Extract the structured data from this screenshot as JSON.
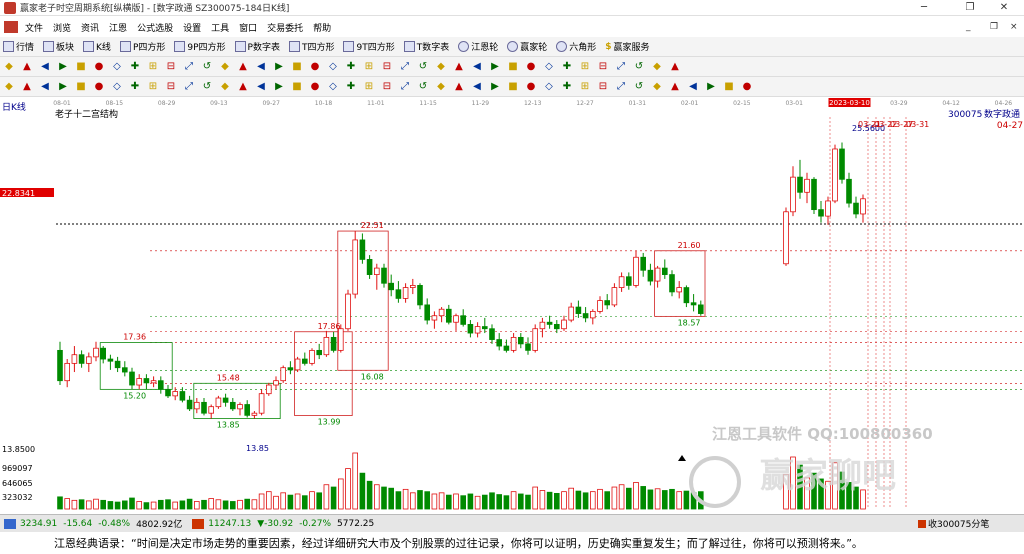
{
  "window": {
    "title": "赢家老子时空周期系统[纵横版] - [数字政通  SZ300075-184日K线]",
    "minimize": "─",
    "restore": "❐",
    "close": "✕"
  },
  "menu": [
    "文件",
    "浏览",
    "资讯",
    "江恩",
    "公式选股",
    "设置",
    "工具",
    "窗口",
    "交易委托",
    "帮助"
  ],
  "mdi_controls": [
    "_",
    "❐",
    "×"
  ],
  "toolbar1": [
    {
      "label": "行情",
      "icon": "grid-icon"
    },
    {
      "label": "板块",
      "icon": "blocks-icon"
    },
    {
      "label": "K线",
      "icon": "kline-icon"
    },
    {
      "label": "P四方形",
      "icon": "p-square-icon"
    },
    {
      "label": "9P四方形",
      "icon": "9p-square-icon"
    },
    {
      "label": "P数字表",
      "icon": "p-table-icon"
    },
    {
      "label": "T四方形",
      "icon": "t-square-icon"
    },
    {
      "label": "9T四方形",
      "icon": "9t-square-icon"
    },
    {
      "label": "T数字表",
      "icon": "t-table-icon"
    },
    {
      "label": "江恩轮",
      "icon": "gann-wheel-icon"
    },
    {
      "label": "赢家轮",
      "icon": "winner-wheel-icon"
    },
    {
      "label": "六角形",
      "icon": "hexagon-icon"
    },
    {
      "label": "赢家服务",
      "icon": "dollar-icon"
    }
  ],
  "toolbar2_count": 38,
  "toolbar3_count": 42,
  "chart_data": {
    "type": "candlestick",
    "title": "老子十二宫结构",
    "period_label": "日K线",
    "stock_code": "300075",
    "stock_name": "数字政通",
    "current_price_label": "22.8341",
    "min_price_label": "13.8500",
    "date_axis": [
      "08-01",
      "08-15",
      "08-29",
      "09-13",
      "09-27",
      "10-18",
      "11-01",
      "11-15",
      "11-29",
      "12-13",
      "12-27",
      "01-31",
      "02-01",
      "02-15",
      "03-01",
      "2023-03-10",
      "03-29",
      "04-12",
      "04-26"
    ],
    "date_axis_right": "04-27",
    "price_range": [
      13.0,
      27.5
    ],
    "volume_ticks": [
      "969097",
      "646065",
      "323032"
    ],
    "candles": [
      {
        "o": 17.0,
        "h": 17.4,
        "l": 15.4,
        "c": 15.6
      },
      {
        "o": 15.6,
        "h": 16.6,
        "l": 15.3,
        "c": 16.4
      },
      {
        "o": 16.4,
        "h": 17.2,
        "l": 16.0,
        "c": 16.8
      },
      {
        "o": 16.8,
        "h": 17.0,
        "l": 16.2,
        "c": 16.4
      },
      {
        "o": 16.4,
        "h": 16.9,
        "l": 16.0,
        "c": 16.7
      },
      {
        "o": 16.7,
        "h": 17.4,
        "l": 16.5,
        "c": 17.1
      },
      {
        "o": 17.1,
        "h": 17.2,
        "l": 16.4,
        "c": 16.6
      },
      {
        "o": 16.6,
        "h": 16.8,
        "l": 16.1,
        "c": 16.5
      },
      {
        "o": 16.5,
        "h": 16.7,
        "l": 16.0,
        "c": 16.2
      },
      {
        "o": 16.2,
        "h": 16.5,
        "l": 15.8,
        "c": 16.0
      },
      {
        "o": 16.0,
        "h": 16.2,
        "l": 15.2,
        "c": 15.4
      },
      {
        "o": 15.4,
        "h": 15.9,
        "l": 15.2,
        "c": 15.7
      },
      {
        "o": 15.7,
        "h": 15.9,
        "l": 15.2,
        "c": 15.5
      },
      {
        "o": 15.5,
        "h": 15.8,
        "l": 15.3,
        "c": 15.6
      },
      {
        "o": 15.6,
        "h": 15.8,
        "l": 15.0,
        "c": 15.2
      },
      {
        "o": 15.2,
        "h": 15.4,
        "l": 14.8,
        "c": 14.9
      },
      {
        "o": 14.9,
        "h": 15.3,
        "l": 14.7,
        "c": 15.1
      },
      {
        "o": 15.1,
        "h": 15.3,
        "l": 14.6,
        "c": 14.7
      },
      {
        "o": 14.7,
        "h": 14.9,
        "l": 14.2,
        "c": 14.3
      },
      {
        "o": 14.3,
        "h": 14.8,
        "l": 14.1,
        "c": 14.6
      },
      {
        "o": 14.6,
        "h": 14.8,
        "l": 14.0,
        "c": 14.1
      },
      {
        "o": 14.1,
        "h": 14.5,
        "l": 13.85,
        "c": 14.4
      },
      {
        "o": 14.4,
        "h": 14.9,
        "l": 14.3,
        "c": 14.8
      },
      {
        "o": 14.8,
        "h": 15.0,
        "l": 14.4,
        "c": 14.6
      },
      {
        "o": 14.6,
        "h": 14.8,
        "l": 14.2,
        "c": 14.3
      },
      {
        "o": 14.3,
        "h": 14.6,
        "l": 14.0,
        "c": 14.5
      },
      {
        "o": 14.5,
        "h": 14.7,
        "l": 13.9,
        "c": 14.0
      },
      {
        "o": 14.0,
        "h": 14.2,
        "l": 13.85,
        "c": 14.1
      },
      {
        "o": 14.1,
        "h": 15.2,
        "l": 14.0,
        "c": 15.0
      },
      {
        "o": 15.0,
        "h": 15.5,
        "l": 14.9,
        "c": 15.4
      },
      {
        "o": 15.4,
        "h": 15.8,
        "l": 15.2,
        "c": 15.6
      },
      {
        "o": 15.6,
        "h": 16.3,
        "l": 15.5,
        "c": 16.2
      },
      {
        "o": 16.2,
        "h": 16.5,
        "l": 15.9,
        "c": 16.1
      },
      {
        "o": 16.1,
        "h": 16.7,
        "l": 16.0,
        "c": 16.6
      },
      {
        "o": 16.6,
        "h": 16.9,
        "l": 16.3,
        "c": 16.4
      },
      {
        "o": 16.4,
        "h": 17.1,
        "l": 16.3,
        "c": 17.0
      },
      {
        "o": 17.0,
        "h": 17.3,
        "l": 16.6,
        "c": 16.8
      },
      {
        "o": 16.8,
        "h": 17.9,
        "l": 16.7,
        "c": 17.6
      },
      {
        "o": 17.6,
        "h": 17.86,
        "l": 16.9,
        "c": 17.0
      },
      {
        "o": 17.0,
        "h": 18.2,
        "l": 16.9,
        "c": 18.0
      },
      {
        "o": 18.0,
        "h": 19.8,
        "l": 17.9,
        "c": 19.6
      },
      {
        "o": 19.6,
        "h": 22.51,
        "l": 19.4,
        "c": 22.1
      },
      {
        "o": 22.1,
        "h": 22.4,
        "l": 21.0,
        "c": 21.2
      },
      {
        "o": 21.2,
        "h": 21.4,
        "l": 20.3,
        "c": 20.5
      },
      {
        "o": 20.5,
        "h": 21.0,
        "l": 19.8,
        "c": 20.8
      },
      {
        "o": 20.8,
        "h": 21.0,
        "l": 19.9,
        "c": 20.1
      },
      {
        "o": 20.1,
        "h": 20.5,
        "l": 19.5,
        "c": 19.8
      },
      {
        "o": 19.8,
        "h": 20.2,
        "l": 19.2,
        "c": 19.4
      },
      {
        "o": 19.4,
        "h": 20.1,
        "l": 19.2,
        "c": 19.9
      },
      {
        "o": 19.9,
        "h": 20.3,
        "l": 19.6,
        "c": 20.0
      },
      {
        "o": 20.0,
        "h": 20.1,
        "l": 18.9,
        "c": 19.1
      },
      {
        "o": 19.1,
        "h": 19.4,
        "l": 18.2,
        "c": 18.4
      },
      {
        "o": 18.4,
        "h": 18.8,
        "l": 18.0,
        "c": 18.6
      },
      {
        "o": 18.6,
        "h": 19.0,
        "l": 18.3,
        "c": 18.9
      },
      {
        "o": 18.9,
        "h": 19.1,
        "l": 18.2,
        "c": 18.3
      },
      {
        "o": 18.3,
        "h": 18.7,
        "l": 17.9,
        "c": 18.6
      },
      {
        "o": 18.6,
        "h": 18.9,
        "l": 18.1,
        "c": 18.2
      },
      {
        "o": 18.2,
        "h": 18.4,
        "l": 17.6,
        "c": 17.8
      },
      {
        "o": 17.8,
        "h": 18.3,
        "l": 17.6,
        "c": 18.1
      },
      {
        "o": 18.1,
        "h": 18.5,
        "l": 17.8,
        "c": 18.0
      },
      {
        "o": 18.0,
        "h": 18.2,
        "l": 17.3,
        "c": 17.5
      },
      {
        "o": 17.5,
        "h": 17.8,
        "l": 17.0,
        "c": 17.2
      },
      {
        "o": 17.2,
        "h": 17.5,
        "l": 16.9,
        "c": 17.0
      },
      {
        "o": 17.0,
        "h": 17.8,
        "l": 16.9,
        "c": 17.6
      },
      {
        "o": 17.6,
        "h": 17.8,
        "l": 17.1,
        "c": 17.3
      },
      {
        "o": 17.3,
        "h": 17.6,
        "l": 16.8,
        "c": 17.0
      },
      {
        "o": 17.0,
        "h": 18.2,
        "l": 16.9,
        "c": 18.0
      },
      {
        "o": 18.0,
        "h": 18.5,
        "l": 17.6,
        "c": 18.3
      },
      {
        "o": 18.3,
        "h": 18.6,
        "l": 18.0,
        "c": 18.2
      },
      {
        "o": 18.2,
        "h": 18.4,
        "l": 17.8,
        "c": 18.0
      },
      {
        "o": 18.0,
        "h": 18.6,
        "l": 17.9,
        "c": 18.4
      },
      {
        "o": 18.4,
        "h": 19.2,
        "l": 18.3,
        "c": 19.0
      },
      {
        "o": 19.0,
        "h": 19.3,
        "l": 18.5,
        "c": 18.7
      },
      {
        "o": 18.7,
        "h": 19.0,
        "l": 18.3,
        "c": 18.5
      },
      {
        "o": 18.5,
        "h": 18.9,
        "l": 18.2,
        "c": 18.8
      },
      {
        "o": 18.8,
        "h": 19.5,
        "l": 18.7,
        "c": 19.3
      },
      {
        "o": 19.3,
        "h": 19.6,
        "l": 18.9,
        "c": 19.1
      },
      {
        "o": 19.1,
        "h": 20.1,
        "l": 19.0,
        "c": 19.9
      },
      {
        "o": 19.9,
        "h": 20.6,
        "l": 19.7,
        "c": 20.4
      },
      {
        "o": 20.4,
        "h": 20.6,
        "l": 19.8,
        "c": 20.0
      },
      {
        "o": 20.0,
        "h": 21.6,
        "l": 19.9,
        "c": 21.3
      },
      {
        "o": 21.3,
        "h": 21.5,
        "l": 20.4,
        "c": 20.7
      },
      {
        "o": 20.7,
        "h": 21.0,
        "l": 20.0,
        "c": 20.2
      },
      {
        "o": 20.2,
        "h": 20.9,
        "l": 19.9,
        "c": 20.8
      },
      {
        "o": 20.8,
        "h": 21.2,
        "l": 20.3,
        "c": 20.5
      },
      {
        "o": 20.5,
        "h": 20.7,
        "l": 19.5,
        "c": 19.7
      },
      {
        "o": 19.7,
        "h": 20.2,
        "l": 19.4,
        "c": 19.9
      },
      {
        "o": 19.9,
        "h": 20.0,
        "l": 19.0,
        "c": 19.2
      },
      {
        "o": 19.2,
        "h": 19.6,
        "l": 18.8,
        "c": 19.1
      },
      {
        "o": 19.1,
        "h": 19.3,
        "l": 18.6,
        "c": 18.7
      },
      {
        "o": 21.0,
        "h": 23.6,
        "l": 20.9,
        "c": 23.4
      },
      {
        "o": 23.4,
        "h": 25.5,
        "l": 23.2,
        "c": 25.0
      },
      {
        "o": 25.0,
        "h": 25.8,
        "l": 24.0,
        "c": 24.3
      },
      {
        "o": 24.3,
        "h": 25.2,
        "l": 23.8,
        "c": 24.9
      },
      {
        "o": 24.9,
        "h": 25.0,
        "l": 23.3,
        "c": 23.5
      },
      {
        "o": 23.5,
        "h": 23.9,
        "l": 22.9,
        "c": 23.2
      },
      {
        "o": 23.2,
        "h": 24.1,
        "l": 22.8,
        "c": 23.9
      },
      {
        "o": 23.9,
        "h": 26.5,
        "l": 23.8,
        "c": 26.3
      },
      {
        "o": 26.3,
        "h": 26.6,
        "l": 24.7,
        "c": 24.9
      },
      {
        "o": 24.9,
        "h": 25.2,
        "l": 23.6,
        "c": 23.8
      },
      {
        "o": 23.8,
        "h": 24.1,
        "l": 23.1,
        "c": 23.3
      },
      {
        "o": 23.3,
        "h": 24.2,
        "l": 22.9,
        "c": 24.0
      }
    ],
    "volumes": [
      210000,
      180000,
      150000,
      160000,
      140000,
      170000,
      150000,
      130000,
      120000,
      140000,
      190000,
      130000,
      110000,
      120000,
      150000,
      160000,
      120000,
      140000,
      170000,
      130000,
      150000,
      180000,
      160000,
      140000,
      130000,
      150000,
      170000,
      160000,
      260000,
      300000,
      220000,
      280000,
      240000,
      260000,
      230000,
      300000,
      280000,
      420000,
      380000,
      520000,
      700000,
      969097,
      620000,
      480000,
      420000,
      380000,
      360000,
      300000,
      340000,
      280000,
      320000,
      300000,
      260000,
      280000,
      240000,
      260000,
      230000,
      260000,
      220000,
      240000,
      280000,
      250000,
      230000,
      300000,
      260000,
      240000,
      380000,
      320000,
      290000,
      270000,
      300000,
      360000,
      310000,
      280000,
      300000,
      340000,
      300000,
      380000,
      420000,
      360000,
      460000,
      390000,
      330000,
      350000,
      320000,
      340000,
      300000,
      310000,
      280000,
      300000,
      600000,
      900000,
      760000,
      540000,
      620000,
      520000,
      480000,
      800000,
      640000,
      460000,
      380000,
      330000
    ],
    "boxes": [
      {
        "label_top": "17.36",
        "label_bottom": "15.20"
      },
      {
        "label_top": "15.48",
        "label_bottom": "13.85"
      },
      {
        "label_top": "17.86",
        "label_bottom": "13.99"
      },
      {
        "label_top": "22.51",
        "label_bottom": "16.08"
      },
      {
        "label_top": "21.60",
        "label_bottom": "18.57"
      }
    ],
    "annotations": [
      "13.85",
      "25.5600",
      "03-21",
      "03-22",
      "03-27",
      "03-31"
    ],
    "watermarks": [
      "江恩工具软件  QQ:100800360",
      "赢家聊吧"
    ]
  },
  "status": {
    "sh_index": "3234.91",
    "sh_change": "-15.64",
    "sh_pct": "-0.48%",
    "sh_amount": "4802.92亿",
    "sz_index": "11247.13",
    "sz_change": "▼-30.92",
    "sz_pct": "-0.27%",
    "sz_amount": "5772.25",
    "right": "收300075分笔"
  },
  "quote": "江恩经典语录：“时间是决定市场走势的重要因素，经过详细研究大市及个别股票的过往记录，你将可以证明，历史确实重复发生；而了解过往，你将可以预测将来。”。"
}
